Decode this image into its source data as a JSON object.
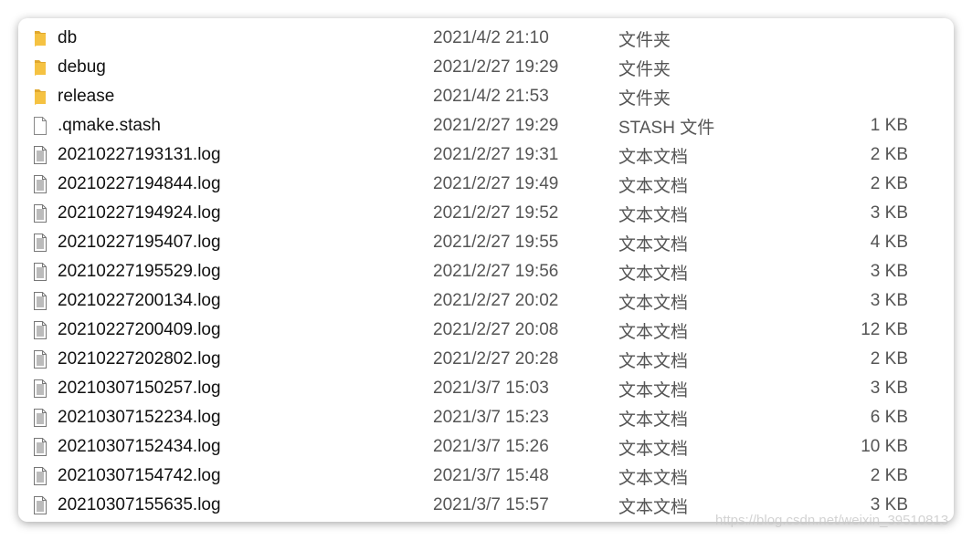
{
  "files": [
    {
      "name": "db",
      "date": "2021/4/2 21:10",
      "type": "文件夹",
      "size": "",
      "icon": "folder-icon"
    },
    {
      "name": "debug",
      "date": "2021/2/27 19:29",
      "type": "文件夹",
      "size": "",
      "icon": "folder-icon"
    },
    {
      "name": "release",
      "date": "2021/4/2 21:53",
      "type": "文件夹",
      "size": "",
      "icon": "folder-icon"
    },
    {
      "name": ".qmake.stash",
      "date": "2021/2/27 19:29",
      "type": "STASH 文件",
      "size": "1 KB",
      "icon": "file-icon"
    },
    {
      "name": "20210227193131.log",
      "date": "2021/2/27 19:31",
      "type": "文本文档",
      "size": "2 KB",
      "icon": "text-file-icon"
    },
    {
      "name": "20210227194844.log",
      "date": "2021/2/27 19:49",
      "type": "文本文档",
      "size": "2 KB",
      "icon": "text-file-icon"
    },
    {
      "name": "20210227194924.log",
      "date": "2021/2/27 19:52",
      "type": "文本文档",
      "size": "3 KB",
      "icon": "text-file-icon"
    },
    {
      "name": "20210227195407.log",
      "date": "2021/2/27 19:55",
      "type": "文本文档",
      "size": "4 KB",
      "icon": "text-file-icon"
    },
    {
      "name": "20210227195529.log",
      "date": "2021/2/27 19:56",
      "type": "文本文档",
      "size": "3 KB",
      "icon": "text-file-icon"
    },
    {
      "name": "20210227200134.log",
      "date": "2021/2/27 20:02",
      "type": "文本文档",
      "size": "3 KB",
      "icon": "text-file-icon"
    },
    {
      "name": "20210227200409.log",
      "date": "2021/2/27 20:08",
      "type": "文本文档",
      "size": "12 KB",
      "icon": "text-file-icon"
    },
    {
      "name": "20210227202802.log",
      "date": "2021/2/27 20:28",
      "type": "文本文档",
      "size": "2 KB",
      "icon": "text-file-icon"
    },
    {
      "name": "20210307150257.log",
      "date": "2021/3/7 15:03",
      "type": "文本文档",
      "size": "3 KB",
      "icon": "text-file-icon"
    },
    {
      "name": "20210307152234.log",
      "date": "2021/3/7 15:23",
      "type": "文本文档",
      "size": "6 KB",
      "icon": "text-file-icon"
    },
    {
      "name": "20210307152434.log",
      "date": "2021/3/7 15:26",
      "type": "文本文档",
      "size": "10 KB",
      "icon": "text-file-icon"
    },
    {
      "name": "20210307154742.log",
      "date": "2021/3/7 15:48",
      "type": "文本文档",
      "size": "2 KB",
      "icon": "text-file-icon"
    },
    {
      "name": "20210307155635.log",
      "date": "2021/3/7 15:57",
      "type": "文本文档",
      "size": "3 KB",
      "icon": "text-file-icon"
    }
  ],
  "watermark": "https://blog.csdn.net/weixin_39510813",
  "colors": {
    "folder": "#f5c242",
    "folder_dark": "#e0a82e"
  }
}
